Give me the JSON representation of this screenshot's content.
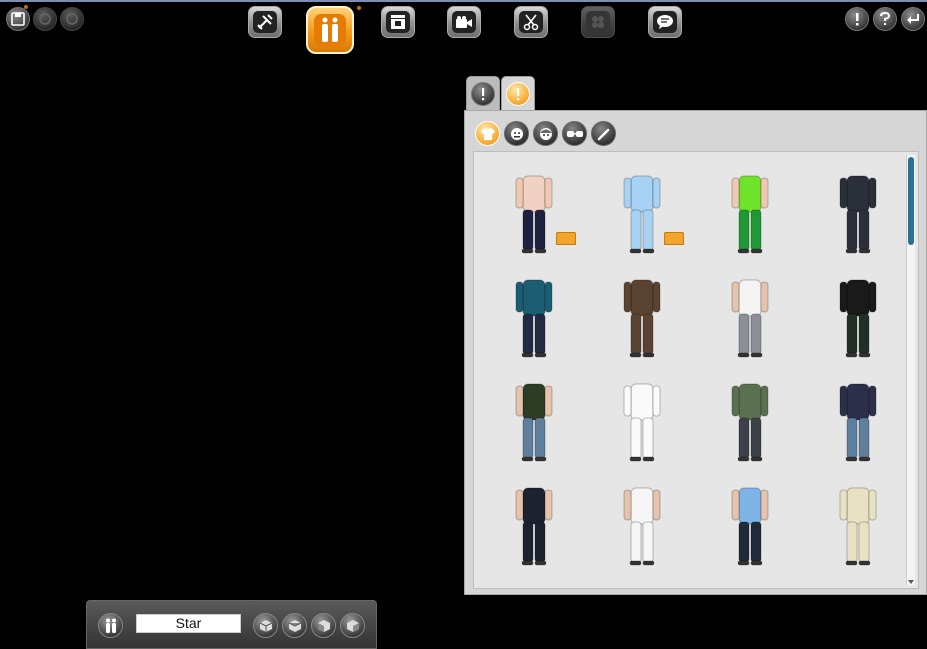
{
  "toolbar": {
    "left_icons": [
      "save-icon",
      "undo-icon",
      "redo-icon"
    ],
    "main_icons": [
      "tools-icon",
      "characters-icon",
      "scene-icon",
      "camera-icon",
      "cut-icon",
      "props-icon",
      "speech-icon"
    ],
    "right_icons": [
      "info-icon",
      "help-icon",
      "exit-icon"
    ]
  },
  "panel": {
    "tabs": [
      "info-tab",
      "wardrobe-tab"
    ],
    "subtabs": [
      "clothing-icon",
      "face-icon",
      "head-icon",
      "glasses-icon",
      "brush-icon"
    ],
    "items": [
      {
        "name": "underwear-body",
        "top": "#f1d2c2",
        "bottom": "#1e2140",
        "skin": "#f0c9b3",
        "folder": true
      },
      {
        "name": "blue-mascot-suit",
        "top": "#a8d2f3",
        "bottom": "#a8d2f3",
        "skin": "#a8d2f3",
        "folder": true
      },
      {
        "name": "green-tshirt-shorts",
        "top": "#6fe22b",
        "bottom": "#1d9a33",
        "skin": "#f0c9b3",
        "folder": false
      },
      {
        "name": "dark-suit",
        "top": "#2a2f3a",
        "bottom": "#2a2f3a",
        "skin": "#2a2f3a",
        "folder": false
      },
      {
        "name": "teal-hoodie-jeans",
        "top": "#1c5d73",
        "bottom": "#222a44",
        "skin": "#1c5d73",
        "folder": false
      },
      {
        "name": "brown-suit",
        "top": "#5a4330",
        "bottom": "#5a4330",
        "skin": "#5a4330",
        "folder": false
      },
      {
        "name": "white-tshirt-jeans",
        "top": "#f4f4f4",
        "bottom": "#8a8f98",
        "skin": "#e6c3ac",
        "folder": false
      },
      {
        "name": "black-jacket",
        "top": "#1a1a1a",
        "bottom": "#1f3027",
        "skin": "#1a1a1a",
        "folder": false
      },
      {
        "name": "camo-shirt-jeans",
        "top": "#2d3d25",
        "bottom": "#5e7e9e",
        "skin": "#e6c3ac",
        "folder": false
      },
      {
        "name": "white-mannequin",
        "top": "#fafafa",
        "bottom": "#fafafa",
        "skin": "#fafafa",
        "folder": false
      },
      {
        "name": "green-hoodie",
        "top": "#5a7050",
        "bottom": "#3c4048",
        "skin": "#5a7050",
        "folder": false
      },
      {
        "name": "navy-hoodie-jeans",
        "top": "#2b2f4a",
        "bottom": "#5e7e9e",
        "skin": "#2b2f4a",
        "folder": false
      },
      {
        "name": "long-dark-coat",
        "top": "#1d2230",
        "bottom": "#1d2230",
        "skin": "#e6c3ac",
        "folder": false
      },
      {
        "name": "white-bathrobe",
        "top": "#f6f6f6",
        "bottom": "#f6f6f6",
        "skin": "#e6c3ac",
        "folder": false
      },
      {
        "name": "blue-tshirt-shorts",
        "top": "#7fb5e6",
        "bottom": "#1f2a3a",
        "skin": "#e6c3ac",
        "folder": false
      },
      {
        "name": "skeleton",
        "top": "#e9e2c2",
        "bottom": "#e9e2c2",
        "skin": "#e9e2c2",
        "folder": false
      }
    ]
  },
  "bottom_bar": {
    "character_name": "Star",
    "view_icons": [
      "view-cube-1-icon",
      "view-cube-2-icon",
      "view-cube-3-icon",
      "view-cube-4-icon"
    ]
  }
}
